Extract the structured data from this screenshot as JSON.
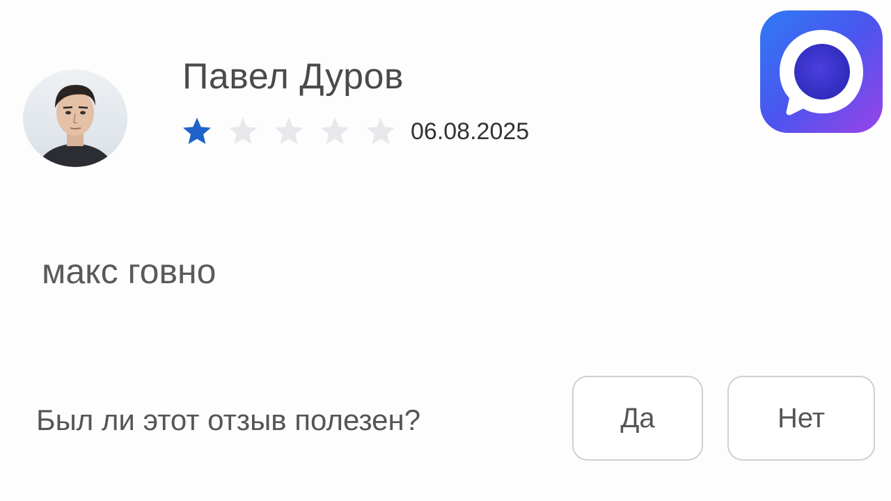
{
  "review": {
    "author_name": "Павел Дуров",
    "rating": 1,
    "max_rating": 5,
    "date": "06.08.2025",
    "text": "макс говно"
  },
  "helpful": {
    "question": "Был ли этот отзыв полезен?",
    "yes_label": "Да",
    "no_label": "Нет"
  },
  "colors": {
    "star_filled": "#1e63c9",
    "star_empty": "#e6e8ec",
    "text_primary": "#4a4a4a"
  },
  "icons": {
    "app_icon": "max-messenger-icon",
    "avatar": "user-avatar",
    "star": "star-icon"
  }
}
